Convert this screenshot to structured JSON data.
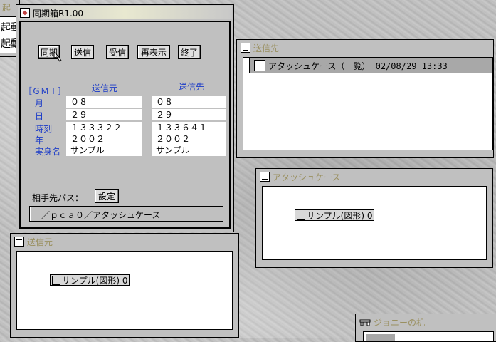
{
  "desktop": {
    "bg_windows": {
      "title_fragment": "起",
      "menu_item_1": "起動",
      "menu_item_2": "起動"
    }
  },
  "main_window": {
    "title": "同期箱R1.00",
    "buttons": {
      "sync": "同期",
      "send": "送信",
      "receive": "受信",
      "redisplay": "再表示",
      "exit": "終了"
    },
    "gmt_label": "［ＧＭＴ］",
    "source_header": "送信元",
    "dest_header": "送信先",
    "row_labels": {
      "month": "月",
      "day": "日",
      "time": "時刻",
      "year": "年",
      "name": "実身名"
    },
    "source": {
      "month": "０８",
      "day": "２９",
      "time": "１３３３２２",
      "year": "２００２",
      "name": "サンプル"
    },
    "dest": {
      "month": "０８",
      "day": "２９",
      "time": "１３３６４１",
      "year": "２００２",
      "name": "サンプル"
    },
    "peer_path_label": "相手先パス：",
    "set_button": "設定",
    "path_value": "／ｐｃａ０／アタッシュケース"
  },
  "dest_window": {
    "title": "送信先",
    "item": "アタッシュケース（一覧） 02/08/29 13:33"
  },
  "case_window": {
    "title": "アタッシュケース",
    "item": "サンプル(図形) 0"
  },
  "source_window": {
    "title": "送信元",
    "item": "サンプル(図形) 0"
  },
  "desk_window": {
    "title": "ジョニーの机"
  },
  "colors": {
    "header_blue": "#1c3cc8",
    "inactive_title": "#9a9060",
    "selected_row": "#a8a8a8"
  }
}
